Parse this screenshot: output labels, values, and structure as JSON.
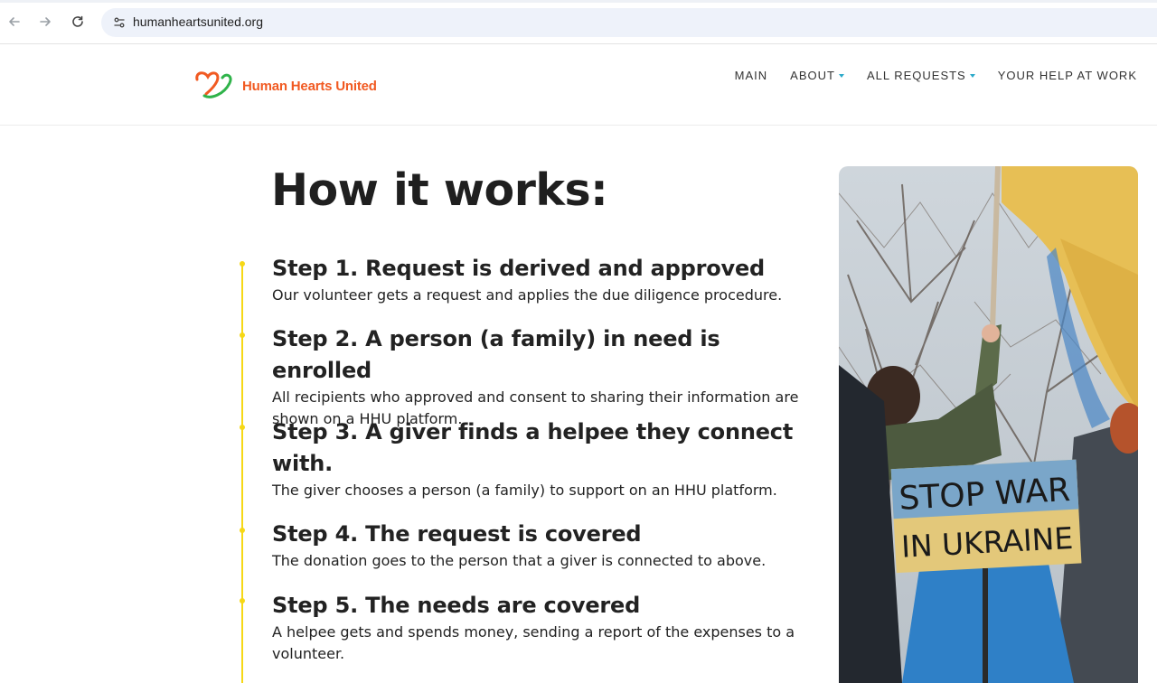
{
  "browser": {
    "url": "humanheartsunited.org",
    "icons": [
      "back-arrow-icon",
      "forward-arrow-icon",
      "reload-icon",
      "site-settings-icon"
    ]
  },
  "header": {
    "logo_text": "Human Hearts United",
    "nav": [
      {
        "label": "MAIN",
        "has_dropdown": false
      },
      {
        "label": "ABOUT",
        "has_dropdown": true
      },
      {
        "label": "ALL REQUESTS",
        "has_dropdown": true
      },
      {
        "label": "YOUR HELP AT WORK",
        "has_dropdown": false
      }
    ]
  },
  "main": {
    "title": "How it works:",
    "steps": [
      {
        "title": "Step 1. Request is derived and approved",
        "desc": "Our volunteer gets a request and applies the due diligence procedure."
      },
      {
        "title": "Step 2. A person (a family) in need is enrolled",
        "desc": "All recipients who approved and consent to sharing their information are shown on a HHU platform."
      },
      {
        "title": "Step 3. A giver finds a helpee they connect with.",
        "desc": "The giver chooses a person (a family) to support on an HHU platform."
      },
      {
        "title": "Step 4. The request is covered",
        "desc": "The donation goes to the person that a giver is connected to above."
      },
      {
        "title": "Step 5. The needs are covered",
        "desc": "A helpee gets and spends money, sending a report of the expenses to a volunteer."
      }
    ],
    "photo_sign_lines": [
      "STOP WAR",
      "IN UKRAINE"
    ]
  },
  "colors": {
    "accent_orange": "#f15a22",
    "accent_green": "#2fb34a",
    "timeline_yellow": "#f6d816",
    "caret_blue": "#2aa9c9"
  }
}
